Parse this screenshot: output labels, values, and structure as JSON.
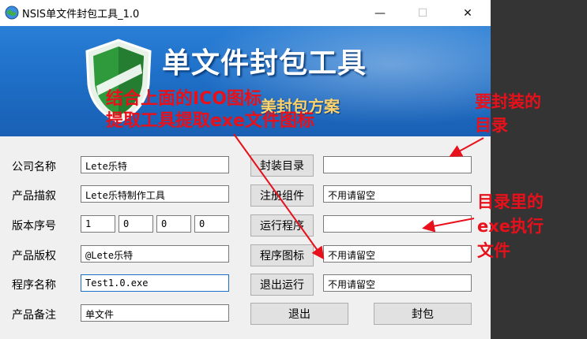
{
  "window": {
    "title": "NSIS单文件封包工具_1.0",
    "minimize": "—",
    "maximize": "☐",
    "close": "✕"
  },
  "banner": {
    "title": "单文件封包工具",
    "slogan": "美封包方案"
  },
  "form": {
    "company": {
      "label": "公司名称",
      "value": "Lete乐特"
    },
    "description": {
      "label": "产品描叙",
      "value": "Lete乐特制作工具"
    },
    "version": {
      "label": "版本序号",
      "values": [
        "1",
        "0",
        "0",
        "0"
      ]
    },
    "copyright": {
      "label": "产品版权",
      "value": "@Lete乐特"
    },
    "program_name": {
      "label": "程序名称",
      "value": "Test1.0.exe"
    },
    "remark": {
      "label": "产品备注",
      "value": "单文件"
    }
  },
  "buttons": {
    "pack_dir": "封装目录",
    "register": "注册组件",
    "run_program": "运行程序",
    "program_icon": "程序图标",
    "exit_run": "退出运行",
    "exit": "退出",
    "pack": "封包"
  },
  "right_fields": {
    "pack_dir": "",
    "register": "不用请留空",
    "run_program": "",
    "program_icon": "不用请留空",
    "exit_run": "不用请留空"
  },
  "annotations": {
    "icon_note_line1": "结合上面的ICO图标",
    "icon_note_line2": "提取工具提取exe文件图标",
    "pack_dir_note_line1": "要封装的",
    "pack_dir_note_line2": "目录",
    "exe_note_line1": "目录里的",
    "exe_note_line2": "exe执行",
    "exe_note_line3": "文件"
  },
  "colors": {
    "annotation": "#e8101a",
    "banner": "#1e6fc8",
    "slogan": "#ffd36b"
  }
}
